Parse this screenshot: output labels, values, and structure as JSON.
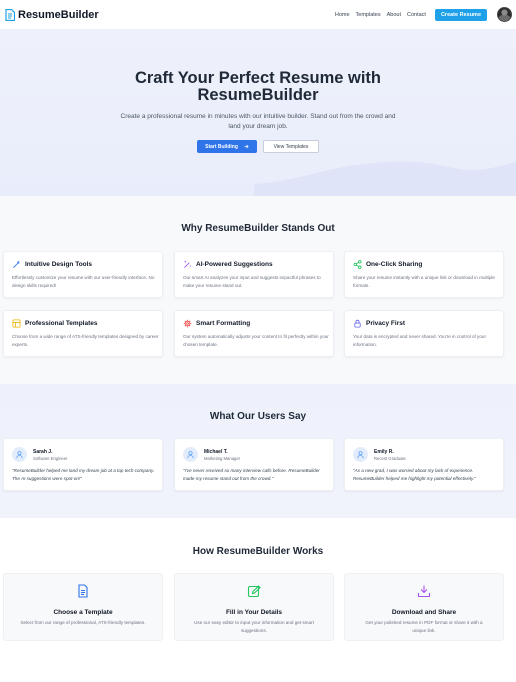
{
  "nav": {
    "brand": "ResumeBuilder",
    "links": [
      "Home",
      "Templates",
      "About",
      "Contact"
    ],
    "cta": "Create Resume"
  },
  "hero": {
    "title_line1": "Craft Your Perfect Resume with",
    "title_line2": "ResumeBuilder",
    "subtitle": "Create a professional resume in minutes with our intuitive builder. Stand out from the crowd and land your dream job.",
    "primary_button": "Start Building",
    "secondary_button": "View Templates"
  },
  "features": {
    "title": "Why ResumeBuilder Stands Out",
    "items": [
      {
        "icon": "magic-wand-icon",
        "color": "#2f74e8",
        "title": "Intuitive Design Tools",
        "desc": "Effortlessly customize your resume with our user-friendly interface. No design skills required!"
      },
      {
        "icon": "sparkle-wand-icon",
        "color": "#a855f7",
        "title": "AI-Powered Suggestions",
        "desc": "Our smart AI analyzes your input and suggests impactful phrases to make your resume stand out."
      },
      {
        "icon": "share-icon",
        "color": "#22c55e",
        "title": "One-Click Sharing",
        "desc": "Share your resume instantly with a unique link or download in multiple formats."
      },
      {
        "icon": "template-icon",
        "color": "#eab308",
        "title": "Professional Templates",
        "desc": "Choose from a wide range of ATS-friendly templates designed by career experts."
      },
      {
        "icon": "gear-icon",
        "color": "#ef4444",
        "title": "Smart Formatting",
        "desc": "Our system automatically adjusts your content to fit perfectly within your chosen template."
      },
      {
        "icon": "lock-icon",
        "color": "#6366f1",
        "title": "Privacy First",
        "desc": "Your data is encrypted and never shared. You're in control of your information."
      }
    ]
  },
  "testimonials": {
    "title": "What Our Users Say",
    "items": [
      {
        "name": "Sarah J.",
        "role": "Software Engineer",
        "quote": "\"ResumeBuilder helped me land my dream job at a top tech company. The AI suggestions were spot-on!\""
      },
      {
        "name": "Michael T.",
        "role": "Marketing Manager",
        "quote": "\"I've never received so many interview calls before. ResumeBuilder made my resume stand out from the crowd.\""
      },
      {
        "name": "Emily R.",
        "role": "Recent Graduate",
        "quote": "\"As a new grad, I was worried about my lack of experience. ResumeBuilder helped me highlight my potential effectively.\""
      }
    ]
  },
  "how": {
    "title": "How ResumeBuilder Works",
    "steps": [
      {
        "icon": "document-icon",
        "color": "#2f74e8",
        "title": "Choose a Template",
        "desc": "Select from our range of professional, ATS-friendly templates."
      },
      {
        "icon": "edit-icon",
        "color": "#22c55e",
        "title": "Fill in Your Details",
        "desc": "Use our easy editor to input your information and get smart suggestions."
      },
      {
        "icon": "download-icon",
        "color": "#a855f7",
        "title": "Download and Share",
        "desc": "Get your polished resume in PDF format or share it with a unique link."
      }
    ]
  },
  "colors": {
    "accent": "#2f74e8",
    "cta": "#1ea1e8",
    "hero_bg": "#eef1fb"
  }
}
